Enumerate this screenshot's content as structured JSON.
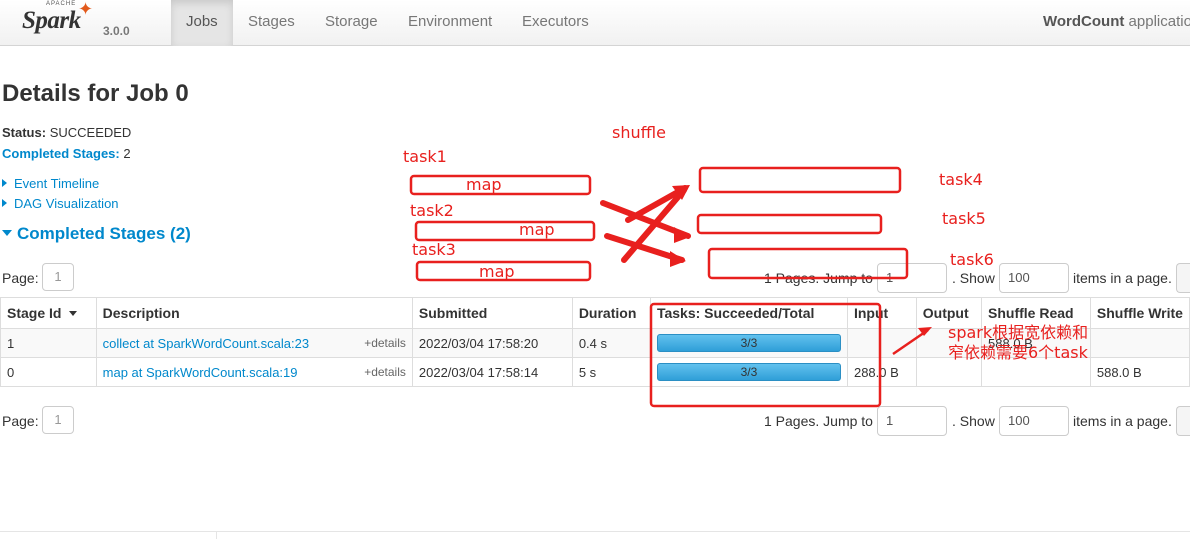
{
  "navbar": {
    "brand_apache": "APACHE",
    "brand_name": "Spark",
    "version": "3.0.0",
    "tabs": [
      {
        "label": "Jobs",
        "active": true
      },
      {
        "label": "Stages"
      },
      {
        "label": "Storage"
      },
      {
        "label": "Environment"
      },
      {
        "label": "Executors"
      }
    ],
    "app_name_bold": "WordCount",
    "app_name_rest": " applicatio"
  },
  "page": {
    "title": "Details for Job 0",
    "status_key": "Status:",
    "status_value": "SUCCEEDED",
    "completed_stages_key": "Completed Stages:",
    "completed_stages_value": "2",
    "event_timeline": "Event Timeline",
    "dag_visualization": "DAG Visualization",
    "section_title": "Completed Stages (2)"
  },
  "pagination": {
    "page_label": "Page:",
    "page_number": "1",
    "pages_text": "1 Pages. Jump to",
    "jump_value": "1",
    "show_text": ". Show",
    "show_value": "100",
    "items_text": "items in a page."
  },
  "table": {
    "headers": [
      "Stage Id",
      "Description",
      "Submitted",
      "Duration",
      "Tasks: Succeeded/Total",
      "Input",
      "Output",
      "Shuffle Read",
      "Shuffle Write"
    ],
    "rows": [
      {
        "stage_id": "1",
        "description": "collect at SparkWordCount.scala:23",
        "details": "+details",
        "submitted": "2022/03/04 17:58:20",
        "duration": "0.4 s",
        "tasks": "3/3",
        "tasks_fraction": 1.0,
        "input": "",
        "output": "",
        "shuffle_read": "588.0 B",
        "shuffle_write": ""
      },
      {
        "stage_id": "0",
        "description": "map at SparkWordCount.scala:19",
        "details": "+details",
        "submitted": "2022/03/04 17:58:14",
        "duration": "5 s",
        "tasks": "3/3",
        "tasks_fraction": 1.0,
        "input": "288.0 B",
        "output": "",
        "shuffle_read": "",
        "shuffle_write": "588.0 B"
      }
    ]
  },
  "annotations": {
    "shuffle": "shuffle",
    "task1": "task1",
    "task2": "task2",
    "task3": "task3",
    "task4": "task4",
    "task5": "task5",
    "task6": "task6",
    "map1": "map",
    "map2": "map",
    "map3": "map",
    "note_line1": "spark根据宽依赖和",
    "note_line2": "窄依赖需要6个task",
    "color": "#e8201e"
  },
  "colors": {
    "link": "#0088cc",
    "progress": "#3ea9e0",
    "navbar_bg": "#f5f5f5"
  }
}
